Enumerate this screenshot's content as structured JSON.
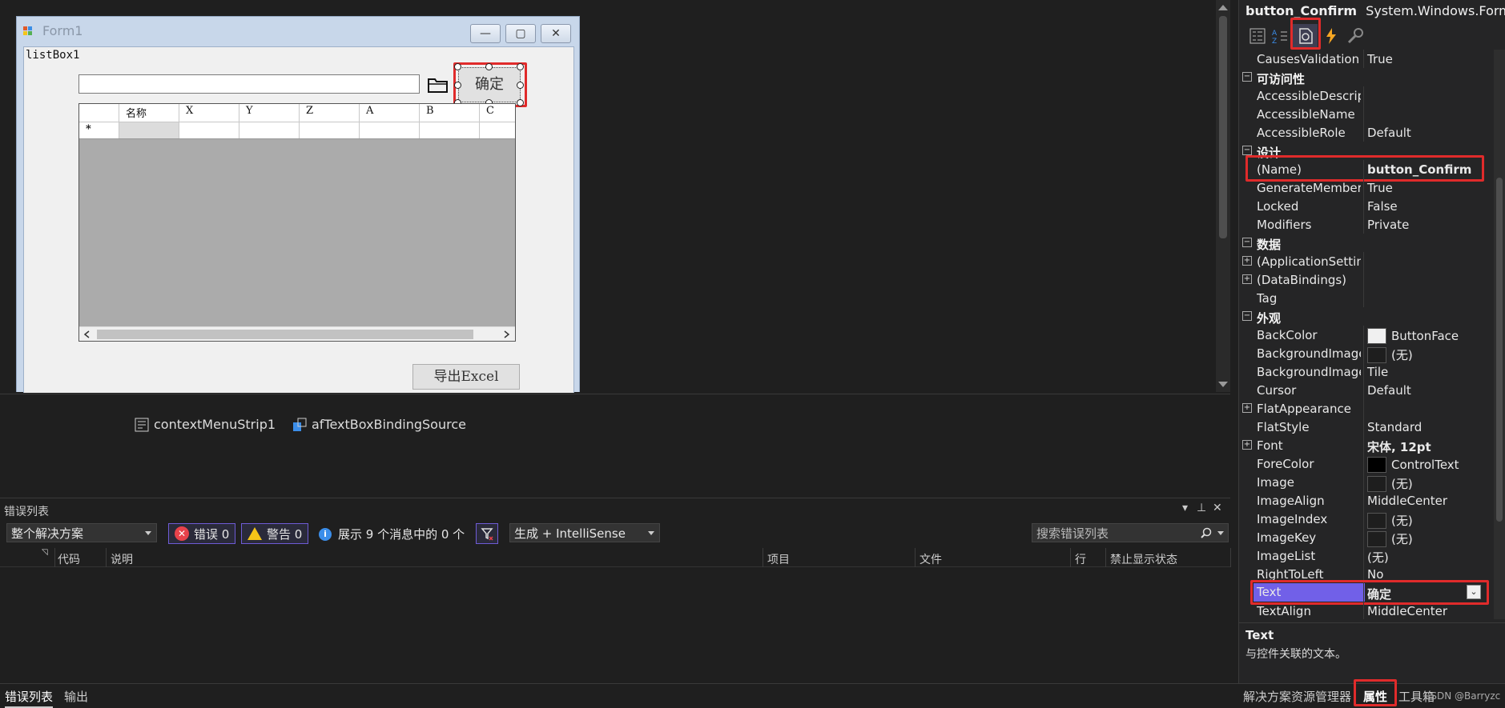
{
  "designer": {
    "form_title": "Form1",
    "listbox_label": "listBox1",
    "confirm_button": "确定",
    "export_button": "导出Excel",
    "grid_columns": [
      "名称",
      "X",
      "Y",
      "Z",
      "A",
      "B",
      "C"
    ],
    "new_row_marker": "*",
    "window_buttons": [
      "—",
      "▢",
      "✕"
    ]
  },
  "tray": {
    "items": [
      "contextMenuStrip1",
      "afTextBoxBindingSource"
    ]
  },
  "error_list": {
    "title": "错误列表",
    "scope": "整个解决方案",
    "errors_label": "错误 0",
    "warnings_label": "警告 0",
    "messages_label": "展示 9 个消息中的 0 个",
    "build_filter": "生成 + IntelliSense",
    "search_placeholder": "搜索错误列表",
    "columns": [
      "代码",
      "说明",
      "项目",
      "文件",
      "行",
      "禁止显示状态"
    ],
    "panel_controls": [
      "▾",
      "⊥",
      "✕"
    ]
  },
  "bottom_tabs": {
    "left": [
      "错误列表",
      "输出"
    ],
    "right": [
      "解决方案资源管理器",
      "属性",
      "工具箱"
    ],
    "watermark": "CSDN @Barryzc"
  },
  "properties": {
    "object_name": "button_Confirm",
    "object_type": "System.Windows.Form",
    "toolbar_icons": [
      "categorized-icon",
      "alphabetical-icon",
      "properties-icon",
      "events-icon",
      "property-pages-icon"
    ],
    "rows": [
      {
        "kind": "prop",
        "name": "CausesValidation",
        "value": "True"
      },
      {
        "kind": "cat",
        "name": "可访问性"
      },
      {
        "kind": "prop",
        "name": "AccessibleDescrip",
        "value": ""
      },
      {
        "kind": "prop",
        "name": "AccessibleName",
        "value": ""
      },
      {
        "kind": "prop",
        "name": "AccessibleRole",
        "value": "Default"
      },
      {
        "kind": "cat",
        "name": "设计"
      },
      {
        "kind": "prop",
        "name": "(Name)",
        "value": "button_Confirm",
        "bold": true,
        "highlight": "box"
      },
      {
        "kind": "prop",
        "name": "GenerateMember",
        "value": "True"
      },
      {
        "kind": "prop",
        "name": "Locked",
        "value": "False"
      },
      {
        "kind": "prop",
        "name": "Modifiers",
        "value": "Private"
      },
      {
        "kind": "cat",
        "name": "数据"
      },
      {
        "kind": "prop",
        "name": "(ApplicationSettin",
        "value": "",
        "expand": true
      },
      {
        "kind": "prop",
        "name": "(DataBindings)",
        "value": "",
        "expand": true
      },
      {
        "kind": "prop",
        "name": "Tag",
        "value": ""
      },
      {
        "kind": "cat",
        "name": "外观"
      },
      {
        "kind": "prop",
        "name": "BackColor",
        "value": "ButtonFace",
        "swatch": "#f0f0f0"
      },
      {
        "kind": "prop",
        "name": "BackgroundImage",
        "value": "(无)",
        "swatch": "#1e1e1e"
      },
      {
        "kind": "prop",
        "name": "BackgroundImage",
        "value": "Tile"
      },
      {
        "kind": "prop",
        "name": "Cursor",
        "value": "Default"
      },
      {
        "kind": "prop",
        "name": "FlatAppearance",
        "value": "",
        "expand": true
      },
      {
        "kind": "prop",
        "name": "FlatStyle",
        "value": "Standard"
      },
      {
        "kind": "prop",
        "name": "Font",
        "value": "宋体, 12pt",
        "bold": true,
        "expand": true
      },
      {
        "kind": "prop",
        "name": "ForeColor",
        "value": "ControlText",
        "swatch": "#000000"
      },
      {
        "kind": "prop",
        "name": "Image",
        "value": "(无)",
        "swatch": "#1e1e1e"
      },
      {
        "kind": "prop",
        "name": "ImageAlign",
        "value": "MiddleCenter"
      },
      {
        "kind": "prop",
        "name": "ImageIndex",
        "value": "(无)",
        "swatch": "#1e1e1e"
      },
      {
        "kind": "prop",
        "name": "ImageKey",
        "value": "(无)",
        "swatch": "#1e1e1e"
      },
      {
        "kind": "prop",
        "name": "ImageList",
        "value": "(无)"
      },
      {
        "kind": "prop",
        "name": "RightToLeft",
        "value": "No"
      },
      {
        "kind": "prop",
        "name": "Text",
        "value": "确定",
        "bold": true,
        "highlight": "selected"
      },
      {
        "kind": "prop",
        "name": "TextAlign",
        "value": "MiddleCenter"
      }
    ],
    "description_title": "Text",
    "description_text": "与控件关联的文本。"
  },
  "colors": {
    "accent": "#6e5bd6",
    "highlight_red": "#e02b2b",
    "selected_row": "#7160e8"
  }
}
